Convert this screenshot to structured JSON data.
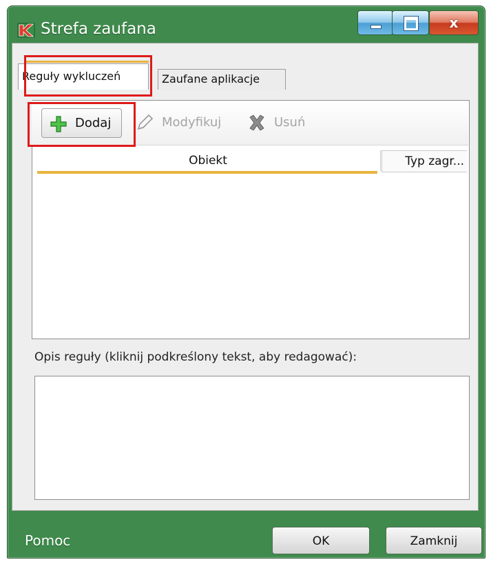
{
  "window": {
    "title": "Strefa zaufana",
    "app_icon": "kaspersky-k-icon"
  },
  "title_controls": {
    "minimize": "minimize-icon",
    "maximize": "maximize-icon",
    "close": "x"
  },
  "tabs": [
    {
      "label": "Reguły wykluczeń",
      "active": true
    },
    {
      "label": "Zaufane aplikacje",
      "active": false
    }
  ],
  "toolbar": {
    "add_label": "Dodaj",
    "modify_label": "Modyfikuj",
    "delete_label": "Usuń"
  },
  "table": {
    "columns": [
      "Obiekt",
      "Typ zagr..."
    ],
    "rows": []
  },
  "description": {
    "label": "Opis reguły (kliknij podkreślony tekst, aby redagować):",
    "text": ""
  },
  "footer": {
    "help": "Pomoc",
    "ok": "OK",
    "close": "Zamknij"
  },
  "colors": {
    "frame": "#3f8a4c",
    "highlight": "#dd1a1a",
    "accent": "#e9b33c"
  }
}
